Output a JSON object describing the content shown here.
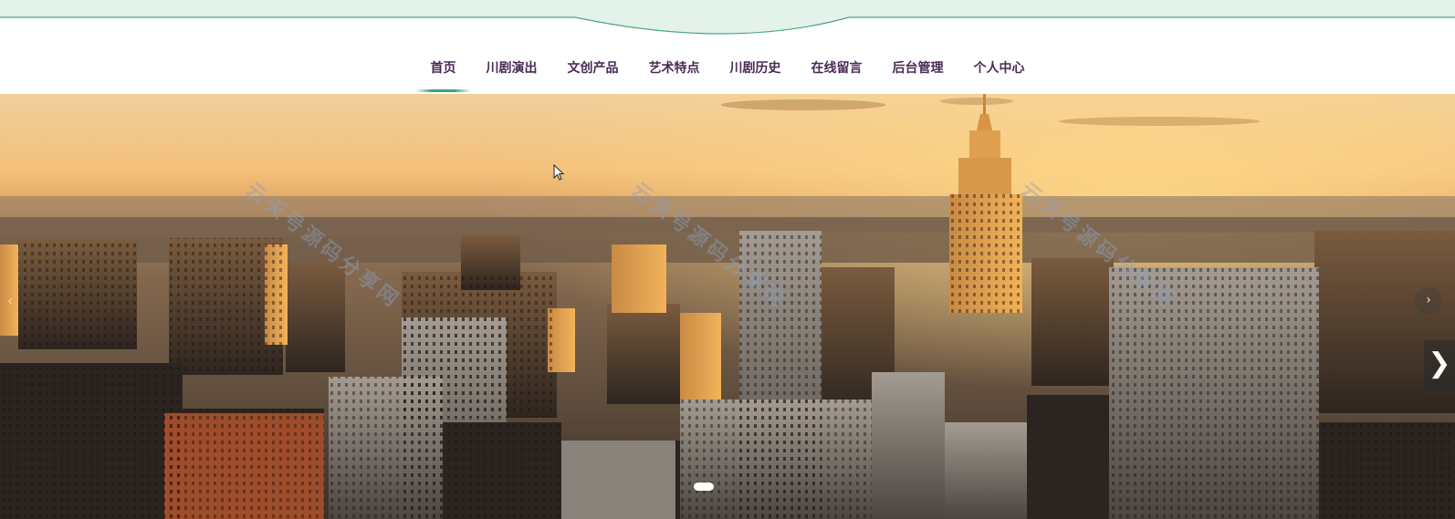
{
  "nav": {
    "items": [
      {
        "label": "首页",
        "active": true
      },
      {
        "label": "川剧演出"
      },
      {
        "label": "文创产品"
      },
      {
        "label": "艺术特点"
      },
      {
        "label": "川剧历史"
      },
      {
        "label": "在线留言"
      },
      {
        "label": "后台管理"
      },
      {
        "label": "个人中心"
      }
    ]
  },
  "banner": {
    "watermark_text": "云天号源码分享网",
    "prev_symbol": "‹",
    "next_symbol": "›",
    "next_big_symbol": "❯",
    "slide_count": 1,
    "active_slide": 1
  },
  "colors": {
    "nav_text": "#4a2a55",
    "nav_active_underline": "#3aa276",
    "top_band": "#e3f2ea",
    "top_band_line": "#4aa57d"
  },
  "icons": {
    "prev": "chevron-left-icon",
    "next": "chevron-right-icon"
  }
}
